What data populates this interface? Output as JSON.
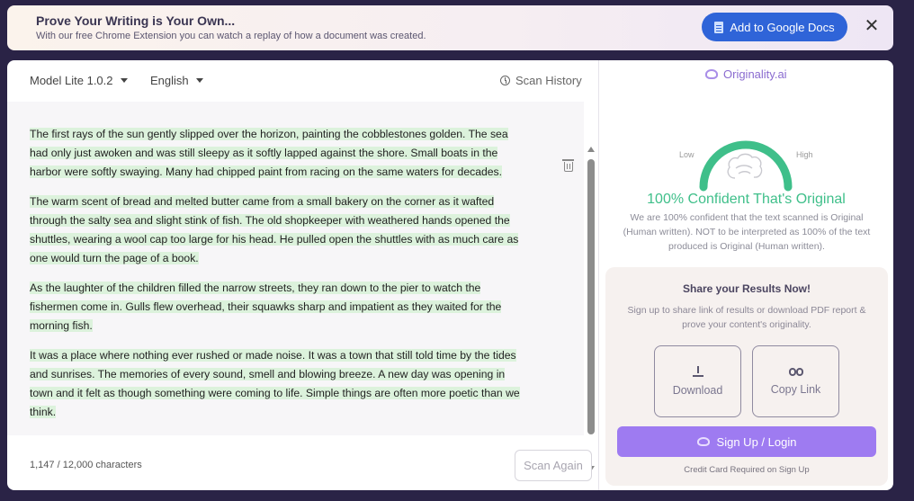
{
  "banner": {
    "title": "Prove Your Writing is Your Own...",
    "subtitle": "With our free Chrome Extension you can watch a replay of how a document was created.",
    "cta_label": "Add to Google Docs",
    "close_label": "✕"
  },
  "editor": {
    "model_label": "Model Lite 1.0.2",
    "language_label": "English",
    "scan_history_label": "Scan History",
    "paragraphs": [
      "The first rays of the sun gently slipped over the horizon, painting the cobblestones golden. The sea had only just awoken and was still sleepy as it softly lapped against the shore. Small boats in the harbor were softly swaying. Many had chipped paint from racing on the same waters for decades.",
      "The warm scent of bread and melted butter came from a small bakery on the corner as it wafted through the salty sea and slight stink of fish. The old shopkeeper with weathered hands opened the shuttles, wearing a wool cap too large for his head. He pulled open the shuttles with as much care as one would turn the page of a book.",
      "As the laughter of the children filled the narrow streets, they ran down to the pier to watch the fishermen come in. Gulls flew overhead, their squawks sharp and impatient as they waited for the morning fish.",
      "It was a place where nothing ever rushed or made noise. It was a town that still told time by the tides and sunrises. The memories of every sound, smell and blowing breeze. A new day was opening in town and it felt as though something were coming to life. Simple things are often more poetic than we think."
    ],
    "char_count": "1,147 / 12,000 characters",
    "scan_again_label": "Scan Again"
  },
  "results": {
    "brand": "Originality.ai",
    "gauge_low": "Low",
    "gauge_high": "High",
    "gauge_value": 1.0,
    "confidence_title": "100% Confident That's Original",
    "confidence_desc": "We are 100% confident that the text scanned is Original (Human written). NOT to be interpreted as 100% of the text produced is Original (Human written).",
    "share_title": "Share your Results Now!",
    "share_desc": "Sign up to share link of results or download PDF report & prove your content's originality.",
    "download_label": "Download",
    "copy_link_label": "Copy Link",
    "signup_label": "Sign Up / Login",
    "credit_note": "Credit Card Required on Sign Up"
  },
  "colors": {
    "background": "#2a2346",
    "primary_blue": "#2f64d8",
    "gauge_green": "#3fbf8a",
    "accent_purple": "#9e7bf1",
    "highlight": "#dcf2dc"
  }
}
